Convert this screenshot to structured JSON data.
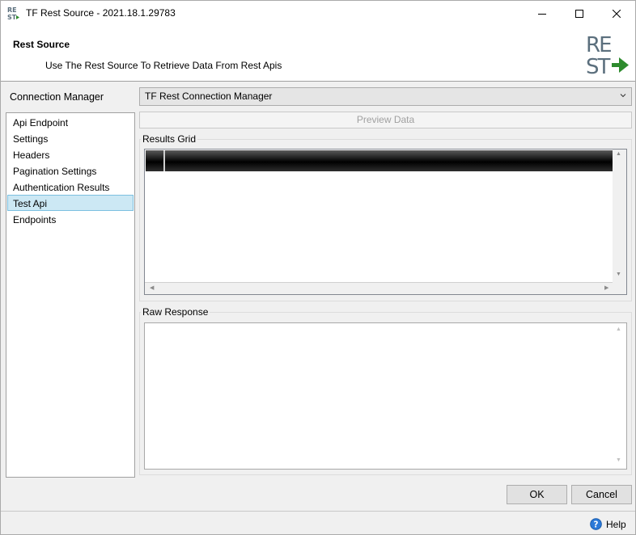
{
  "window": {
    "title": "TF Rest Source - 2021.18.1.29783",
    "min_icon": "minimize-icon",
    "max_icon": "maximize-icon",
    "close_icon": "close-icon"
  },
  "header": {
    "title": "Rest Source",
    "subtitle": "Use The Rest Source To Retrieve Data From Rest Apis",
    "logo_icon": "rest-logo-icon",
    "logo_text": "REST"
  },
  "connection": {
    "label": "Connection Manager",
    "selected": "TF Rest Connection Manager"
  },
  "nav": {
    "items": [
      {
        "label": "Api Endpoint"
      },
      {
        "label": "Settings"
      },
      {
        "label": "Headers"
      },
      {
        "label": "Pagination Settings"
      },
      {
        "label": "Authentication Results"
      },
      {
        "label": "Test Api"
      },
      {
        "label": "Endpoints"
      }
    ],
    "selected": "Test Api"
  },
  "main": {
    "preview_button": "Preview Data",
    "results_grid_label": "Results Grid",
    "raw_response_label": "Raw Response"
  },
  "footer": {
    "ok_label": "OK",
    "cancel_label": "Cancel",
    "help_label": "Help",
    "help_icon": "help-icon"
  },
  "colors": {
    "selection_bg": "#cce8f4",
    "logo_slate": "#5b6f7d",
    "logo_arrow": "#2e8b2e"
  }
}
